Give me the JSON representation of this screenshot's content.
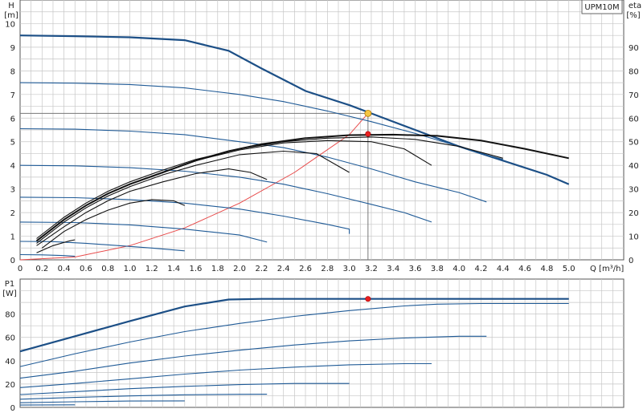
{
  "chart_data": [
    {
      "type": "line",
      "name_tag": "UPM10M",
      "left_axis": {
        "label_top": "H",
        "label_unit": "[m]",
        "ticks": [
          0,
          1,
          2,
          3,
          4,
          5,
          6,
          7,
          8,
          9,
          10
        ],
        "range": [
          0,
          11
        ]
      },
      "right_axis": {
        "label_top": "eta",
        "label_unit": "[%]",
        "ticks": [
          0,
          10,
          20,
          30,
          40,
          50,
          60,
          70,
          80,
          90
        ],
        "range": [
          0,
          110
        ]
      },
      "x_axis": {
        "label": "Q [m³/h]",
        "ticks": [
          0,
          0.2,
          0.4,
          0.6,
          0.8,
          1.0,
          1.2,
          1.4,
          1.6,
          1.8,
          2.0,
          2.2,
          2.4,
          2.6,
          2.8,
          3.0,
          3.2,
          3.4,
          3.6,
          3.8,
          4.0,
          4.2,
          4.4,
          4.6,
          4.8,
          5.0
        ],
        "tick_labels": [
          "0",
          "0.2",
          "0.4",
          "0.6",
          "0.8",
          "1.0",
          "1.2",
          "1.4",
          "1.6",
          "1.8",
          "2.0",
          "2.2",
          "2.4",
          "2.6",
          "2.8",
          "3.0",
          "3.2",
          "3.4",
          "3.6",
          "3.8",
          "4.0",
          "4.2",
          "4.4",
          "4.6",
          "4.8",
          "5.0"
        ],
        "range": [
          0,
          5.5
        ]
      },
      "grid": true,
      "head_curves": [
        {
          "role": "max",
          "points": [
            [
              0,
              9.5
            ],
            [
              0.5,
              9.47
            ],
            [
              1.0,
              9.42
            ],
            [
              1.5,
              9.3
            ],
            [
              1.9,
              8.85
            ],
            [
              2.2,
              8.1
            ],
            [
              2.6,
              7.15
            ],
            [
              3.0,
              6.55
            ],
            [
              3.2,
              6.2
            ],
            [
              3.6,
              5.5
            ],
            [
              4.0,
              4.8
            ],
            [
              4.4,
              4.2
            ],
            [
              4.8,
              3.6
            ],
            [
              5.0,
              3.2
            ]
          ]
        },
        {
          "role": "step",
          "points": [
            [
              0,
              7.5
            ],
            [
              0.5,
              7.48
            ],
            [
              1.0,
              7.42
            ],
            [
              1.5,
              7.28
            ],
            [
              2.0,
              7.0
            ],
            [
              2.4,
              6.7
            ],
            [
              2.8,
              6.3
            ],
            [
              3.2,
              5.85
            ],
            [
              3.6,
              5.35
            ],
            [
              4.0,
              4.8
            ],
            [
              4.2,
              4.5
            ],
            [
              4.4,
              4.25
            ]
          ]
        },
        {
          "role": "step",
          "points": [
            [
              0,
              5.55
            ],
            [
              0.5,
              5.53
            ],
            [
              1.0,
              5.45
            ],
            [
              1.5,
              5.3
            ],
            [
              2.0,
              5.0
            ],
            [
              2.4,
              4.75
            ],
            [
              2.8,
              4.35
            ],
            [
              3.2,
              3.85
            ],
            [
              3.6,
              3.3
            ],
            [
              4.0,
              2.85
            ],
            [
              4.25,
              2.45
            ]
          ]
        },
        {
          "role": "step",
          "points": [
            [
              0,
              4.0
            ],
            [
              0.5,
              3.98
            ],
            [
              1.0,
              3.9
            ],
            [
              1.5,
              3.75
            ],
            [
              2.0,
              3.5
            ],
            [
              2.4,
              3.2
            ],
            [
              2.8,
              2.8
            ],
            [
              3.2,
              2.35
            ],
            [
              3.5,
              2.0
            ],
            [
              3.75,
              1.6
            ]
          ]
        },
        {
          "role": "step",
          "points": [
            [
              0,
              2.65
            ],
            [
              0.5,
              2.63
            ],
            [
              1.0,
              2.55
            ],
            [
              1.5,
              2.4
            ],
            [
              2.0,
              2.15
            ],
            [
              2.4,
              1.85
            ],
            [
              2.8,
              1.5
            ],
            [
              3.0,
              1.3
            ],
            [
              3.0,
              1.1
            ]
          ]
        },
        {
          "role": "step",
          "points": [
            [
              0,
              1.6
            ],
            [
              0.5,
              1.58
            ],
            [
              1.0,
              1.48
            ],
            [
              1.5,
              1.3
            ],
            [
              1.8,
              1.15
            ],
            [
              2.0,
              1.05
            ],
            [
              2.25,
              0.75
            ]
          ]
        },
        {
          "role": "step",
          "points": [
            [
              0,
              0.78
            ],
            [
              0.3,
              0.77
            ],
            [
              0.6,
              0.7
            ],
            [
              0.9,
              0.6
            ],
            [
              1.2,
              0.5
            ],
            [
              1.5,
              0.38
            ]
          ]
        },
        {
          "role": "step",
          "points": [
            [
              0,
              0.22
            ],
            [
              0.2,
              0.21
            ],
            [
              0.4,
              0.18
            ],
            [
              0.5,
              0.15
            ]
          ]
        }
      ],
      "efficiency_curves": [
        {
          "role": "max",
          "points": [
            [
              0.15,
              8
            ],
            [
              0.4,
              17
            ],
            [
              0.6,
              23
            ],
            [
              0.8,
              28
            ],
            [
              1.0,
              32
            ],
            [
              1.3,
              37
            ],
            [
              1.6,
              42
            ],
            [
              1.9,
              46
            ],
            [
              2.2,
              49
            ],
            [
              2.6,
              51.5
            ],
            [
              3.0,
              52.8
            ],
            [
              3.4,
              53
            ],
            [
              3.8,
              52.5
            ],
            [
              4.2,
              50.5
            ],
            [
              4.6,
              47
            ],
            [
              5.0,
              43
            ]
          ]
        },
        {
          "role": "step",
          "points": [
            [
              0.15,
              9
            ],
            [
              0.4,
              18
            ],
            [
              0.6,
              24
            ],
            [
              0.8,
              29
            ],
            [
              1.0,
              33
            ],
            [
              1.3,
              38
            ],
            [
              1.6,
              42.5
            ],
            [
              2.0,
              47
            ],
            [
              2.4,
              50
            ],
            [
              2.8,
              51.5
            ],
            [
              3.2,
              52
            ],
            [
              3.6,
              51
            ],
            [
              4.0,
              48
            ],
            [
              4.4,
              43
            ]
          ]
        },
        {
          "role": "step",
          "points": [
            [
              0.15,
              8
            ],
            [
              0.4,
              17
            ],
            [
              0.6,
              23
            ],
            [
              0.8,
              28
            ],
            [
              1.0,
              32
            ],
            [
              1.3,
              37
            ],
            [
              1.6,
              42
            ],
            [
              2.0,
              46.5
            ],
            [
              2.4,
              49.5
            ],
            [
              2.8,
              50.5
            ],
            [
              3.2,
              50
            ],
            [
              3.5,
              47
            ],
            [
              3.75,
              40
            ]
          ]
        },
        {
          "role": "step",
          "points": [
            [
              0.15,
              7
            ],
            [
              0.4,
              16
            ],
            [
              0.6,
              22
            ],
            [
              0.8,
              27
            ],
            [
              1.0,
              31
            ],
            [
              1.3,
              36
            ],
            [
              1.6,
              40
            ],
            [
              2.0,
              44.5
            ],
            [
              2.4,
              46
            ],
            [
              2.7,
              45
            ],
            [
              3.0,
              37
            ]
          ]
        },
        {
          "role": "step",
          "points": [
            [
              0.15,
              6
            ],
            [
              0.4,
              14
            ],
            [
              0.6,
              20
            ],
            [
              0.8,
              25
            ],
            [
              1.0,
              29
            ],
            [
              1.3,
              33
            ],
            [
              1.6,
              36.5
            ],
            [
              1.9,
              38.5
            ],
            [
              2.1,
              37
            ],
            [
              2.25,
              34
            ]
          ]
        },
        {
          "role": "step",
          "points": [
            [
              0.2,
              5
            ],
            [
              0.4,
              12
            ],
            [
              0.6,
              17
            ],
            [
              0.8,
              21
            ],
            [
              1.0,
              24
            ],
            [
              1.2,
              25.5
            ],
            [
              1.4,
              25
            ],
            [
              1.5,
              23
            ]
          ]
        },
        {
          "role": "step",
          "points": [
            [
              0.15,
              3
            ],
            [
              0.3,
              6
            ],
            [
              0.45,
              8
            ],
            [
              0.5,
              8.5
            ]
          ]
        }
      ],
      "system_curve": {
        "points": [
          [
            0,
            0
          ],
          [
            0.5,
            0.12
          ],
          [
            1.0,
            0.6
          ],
          [
            1.5,
            1.35
          ],
          [
            2.0,
            2.4
          ],
          [
            2.5,
            3.7
          ],
          [
            3.0,
            5.3
          ],
          [
            3.17,
            6.2
          ]
        ],
        "color": "#e84a4a"
      },
      "operating_point": {
        "q": 3.17,
        "h": 6.2,
        "eta": 53.3
      },
      "colors": {
        "max_curve": "#1c4f86",
        "step_curve": "#1f5a96",
        "eta_curve": "#111111",
        "system": "#e84a4a",
        "point_fill": "#f5c542",
        "grid": "#c6c6c6"
      }
    },
    {
      "type": "line",
      "left_axis": {
        "label_top": "P1",
        "label_unit": "[W]",
        "ticks": [
          0,
          20,
          40,
          60,
          80
        ],
        "range": [
          0,
          110
        ]
      },
      "x_axis": {
        "range": [
          0,
          5.5
        ]
      },
      "grid": true,
      "power_curves": [
        {
          "role": "max",
          "points": [
            [
              0,
              48
            ],
            [
              0.5,
              61
            ],
            [
              1.0,
              74
            ],
            [
              1.5,
              86.5
            ],
            [
              1.9,
              92.5
            ],
            [
              2.2,
              93
            ],
            [
              2.5,
              93
            ],
            [
              3.2,
              93
            ],
            [
              4.0,
              93
            ],
            [
              5.0,
              93
            ]
          ]
        },
        {
          "role": "step",
          "points": [
            [
              0,
              35
            ],
            [
              0.5,
              46
            ],
            [
              1.0,
              56
            ],
            [
              1.5,
              65
            ],
            [
              2.0,
              72
            ],
            [
              2.5,
              78
            ],
            [
              3.0,
              83
            ],
            [
              3.5,
              87
            ],
            [
              3.8,
              88.5
            ],
            [
              4.2,
              89
            ],
            [
              4.6,
              89
            ],
            [
              5.0,
              89
            ]
          ]
        },
        {
          "role": "step",
          "points": [
            [
              0,
              25
            ],
            [
              0.5,
              31
            ],
            [
              1.0,
              38
            ],
            [
              1.5,
              44
            ],
            [
              2.0,
              49
            ],
            [
              2.5,
              53.5
            ],
            [
              3.0,
              57
            ],
            [
              3.5,
              59.5
            ],
            [
              4.0,
              61
            ],
            [
              4.25,
              61
            ]
          ]
        },
        {
          "role": "step",
          "points": [
            [
              0,
              17
            ],
            [
              0.5,
              20.5
            ],
            [
              1.0,
              24.5
            ],
            [
              1.5,
              28.5
            ],
            [
              2.0,
              32
            ],
            [
              2.5,
              34.5
            ],
            [
              3.0,
              36.5
            ],
            [
              3.5,
              37.5
            ],
            [
              3.75,
              37.5
            ]
          ]
        },
        {
          "role": "step",
          "points": [
            [
              0,
              11
            ],
            [
              0.5,
              13.5
            ],
            [
              1.0,
              16
            ],
            [
              1.5,
              18
            ],
            [
              2.0,
              19.5
            ],
            [
              2.5,
              20.5
            ],
            [
              3.0,
              20.5
            ]
          ]
        },
        {
          "role": "step",
          "points": [
            [
              0,
              7
            ],
            [
              0.5,
              8.5
            ],
            [
              1.0,
              9.8
            ],
            [
              1.5,
              10.8
            ],
            [
              2.0,
              11.2
            ],
            [
              2.25,
              11.3
            ]
          ]
        },
        {
          "role": "step",
          "points": [
            [
              0,
              4
            ],
            [
              0.5,
              4.8
            ],
            [
              1.0,
              5.4
            ],
            [
              1.5,
              5.6
            ]
          ]
        },
        {
          "role": "step",
          "points": [
            [
              0,
              2
            ],
            [
              0.25,
              2.1
            ],
            [
              0.5,
              2.2
            ]
          ]
        }
      ],
      "operating_point": {
        "q": 3.17,
        "p": 93
      },
      "colors": {
        "max_curve": "#1c4f86",
        "step_curve": "#1f5a96",
        "point": "#e82020",
        "grid": "#c6c6c6"
      }
    }
  ]
}
